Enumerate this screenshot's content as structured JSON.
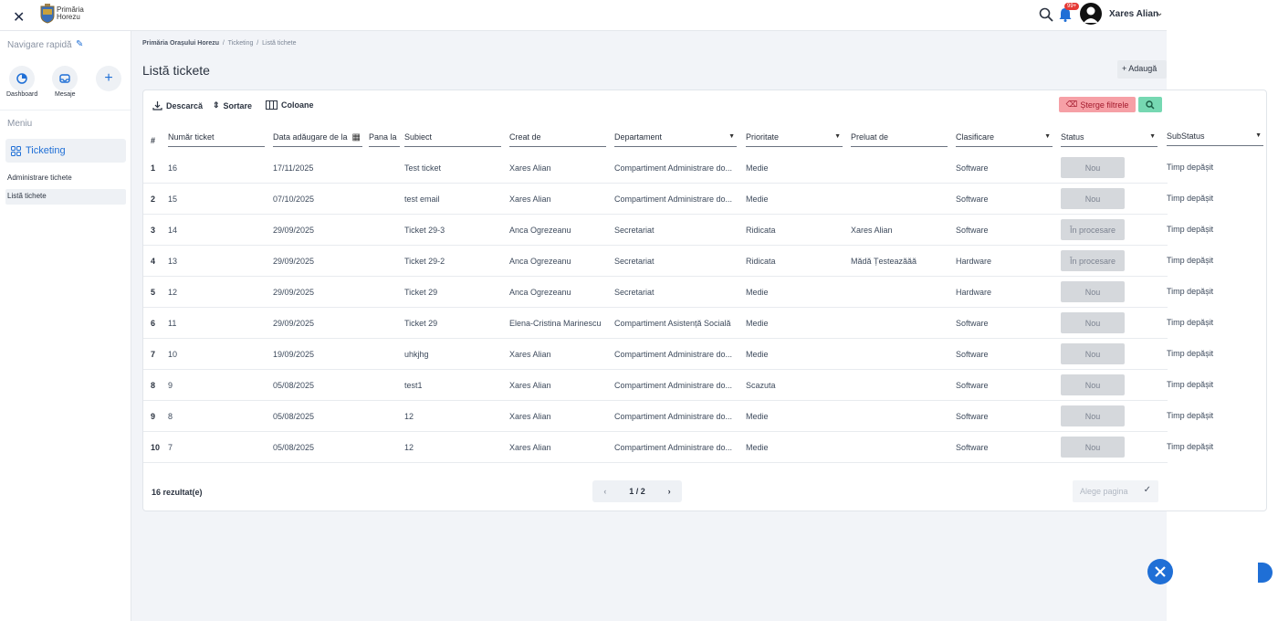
{
  "app": {
    "logo_text_line1": "Primăria",
    "logo_text_line2": "Horezu",
    "notifications_badge": "99+",
    "user_name": "Xares Alian"
  },
  "sidebar": {
    "nav_title": "Navigare rapidă",
    "quick": [
      {
        "label": "Dashboard"
      },
      {
        "label": "Mesaje"
      }
    ],
    "menu_title": "Meniu",
    "section": "Ticketing",
    "items": [
      "Administrare tichete",
      "Listă tichete"
    ]
  },
  "breadcrumb": {
    "root": "Primăria Orașului Horezu",
    "sep": "/",
    "mid": "Ticketing",
    "current": "Listă tichete"
  },
  "page": {
    "title": "Listă tickete",
    "add_label": "+ Adaugă"
  },
  "toolbar": {
    "download": "Descarcă",
    "sort": "Sortare",
    "columns": "Coloane",
    "clear_filters": "Șterge filtrele"
  },
  "table": {
    "hash": "#",
    "headers": {
      "nr": "Număr ticket",
      "date_from": "Data adăugare de la",
      "date_to": "Pana la",
      "subject": "Subiect",
      "created_by": "Creat de",
      "department": "Departament",
      "priority": "Prioritate",
      "taken_by": "Preluat de",
      "classification": "Clasificare",
      "status": "Status",
      "substatus": "SubStatus"
    },
    "rows": [
      {
        "i": "1",
        "nr": "16",
        "date": "17/11/2025",
        "subject": "Test ticket",
        "created": "Xares Alian",
        "dept": "Compartiment Administrare do...",
        "prio": "Medie",
        "taken": "",
        "cls": "Software",
        "status": "Nou",
        "sub": "Timp depășit"
      },
      {
        "i": "2",
        "nr": "15",
        "date": "07/10/2025",
        "subject": "test email",
        "created": "Xares Alian",
        "dept": "Compartiment Administrare do...",
        "prio": "Medie",
        "taken": "",
        "cls": "Software",
        "status": "Nou",
        "sub": "Timp depășit"
      },
      {
        "i": "3",
        "nr": "14",
        "date": "29/09/2025",
        "subject": "Ticket 29-3",
        "created": "Anca Ogrezeanu",
        "dept": "Secretariat",
        "prio": "Ridicata",
        "taken": "Xares Alian",
        "cls": "Software",
        "status": "În procesare",
        "sub": "Timp depășit"
      },
      {
        "i": "4",
        "nr": "13",
        "date": "29/09/2025",
        "subject": "Ticket 29-2",
        "created": "Anca Ogrezeanu",
        "dept": "Secretariat",
        "prio": "Ridicata",
        "taken": "Mădă Țesteazăăă",
        "cls": "Hardware",
        "status": "În procesare",
        "sub": "Timp depășit"
      },
      {
        "i": "5",
        "nr": "12",
        "date": "29/09/2025",
        "subject": "Ticket 29",
        "created": "Anca Ogrezeanu",
        "dept": "Secretariat",
        "prio": "Medie",
        "taken": "",
        "cls": "Hardware",
        "status": "Nou",
        "sub": "Timp depășit"
      },
      {
        "i": "6",
        "nr": "11",
        "date": "29/09/2025",
        "subject": "Ticket 29",
        "created": "Elena-Cristina Marinescu",
        "dept": "Compartiment Asistență Socială",
        "prio": "Medie",
        "taken": "",
        "cls": "Software",
        "status": "Nou",
        "sub": "Timp depășit"
      },
      {
        "i": "7",
        "nr": "10",
        "date": "19/09/2025",
        "subject": "uhkjhg",
        "created": "Xares Alian",
        "dept": "Compartiment Administrare do...",
        "prio": "Medie",
        "taken": "",
        "cls": "Software",
        "status": "Nou",
        "sub": "Timp depășit"
      },
      {
        "i": "8",
        "nr": "9",
        "date": "05/08/2025",
        "subject": "test1",
        "created": "Xares Alian",
        "dept": "Compartiment Administrare do...",
        "prio": "Scazuta",
        "taken": "",
        "cls": "Software",
        "status": "Nou",
        "sub": "Timp depășit"
      },
      {
        "i": "9",
        "nr": "8",
        "date": "05/08/2025",
        "subject": "12",
        "created": "Xares Alian",
        "dept": "Compartiment Administrare do...",
        "prio": "Medie",
        "taken": "",
        "cls": "Software",
        "status": "Nou",
        "sub": "Timp depășit"
      },
      {
        "i": "10",
        "nr": "7",
        "date": "05/08/2025",
        "subject": "12",
        "created": "Xares Alian",
        "dept": "Compartiment Administrare do...",
        "prio": "Medie",
        "taken": "",
        "cls": "Software",
        "status": "Nou",
        "sub": "Timp depășit"
      }
    ]
  },
  "footer": {
    "results": "16 rezultat(e)",
    "pagination": "1 / 2",
    "choose_page_placeholder": "Alege pagina"
  }
}
